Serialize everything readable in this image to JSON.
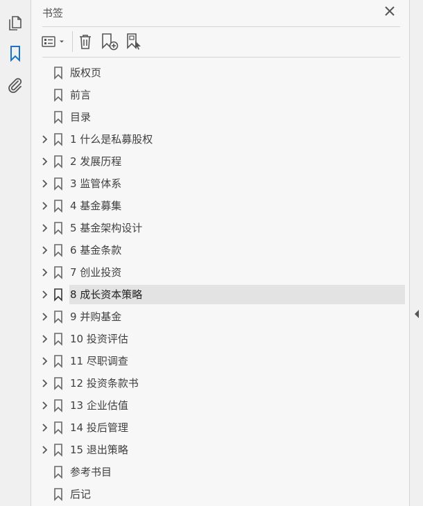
{
  "panel": {
    "title": "书签"
  },
  "bookmarks": [
    {
      "label": "版权页",
      "expandable": false,
      "selected": false
    },
    {
      "label": "前言",
      "expandable": false,
      "selected": false
    },
    {
      "label": "目录",
      "expandable": false,
      "selected": false
    },
    {
      "label": "1 什么是私募股权",
      "expandable": true,
      "selected": false
    },
    {
      "label": "2 发展历程",
      "expandable": true,
      "selected": false
    },
    {
      "label": "3 监管体系",
      "expandable": true,
      "selected": false
    },
    {
      "label": "4 基金募集",
      "expandable": true,
      "selected": false
    },
    {
      "label": "5 基金架构设计",
      "expandable": true,
      "selected": false
    },
    {
      "label": "6 基金条款",
      "expandable": true,
      "selected": false
    },
    {
      "label": "7 创业投资",
      "expandable": true,
      "selected": false
    },
    {
      "label": "8 成长资本策略",
      "expandable": true,
      "selected": true
    },
    {
      "label": "9 并购基金",
      "expandable": true,
      "selected": false
    },
    {
      "label": "10 投资评估",
      "expandable": true,
      "selected": false
    },
    {
      "label": "11 尽职调查",
      "expandable": true,
      "selected": false
    },
    {
      "label": "12 投资条款书",
      "expandable": true,
      "selected": false
    },
    {
      "label": "13 企业估值",
      "expandable": true,
      "selected": false
    },
    {
      "label": "14 投后管理",
      "expandable": true,
      "selected": false
    },
    {
      "label": "15 退出策略",
      "expandable": true,
      "selected": false
    },
    {
      "label": "参考书目",
      "expandable": false,
      "selected": false
    },
    {
      "label": "后记",
      "expandable": false,
      "selected": false
    }
  ],
  "colors": {
    "accent": "#1a73c9",
    "icon": "#555555",
    "selected_bg": "#e3e3e3"
  }
}
